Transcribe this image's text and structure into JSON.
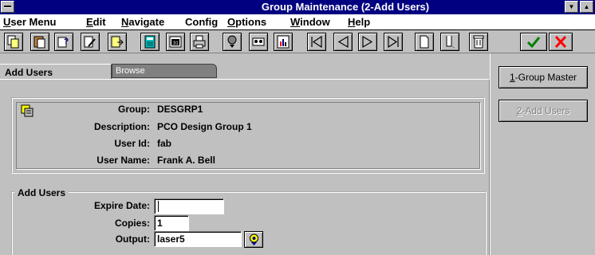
{
  "window": {
    "title": "Group Maintenance (2-Add Users)",
    "minimize_icon": "down-triangle",
    "maximize_icon": "up-triangle"
  },
  "menu": [
    {
      "label": "User Menu",
      "mnemonic": "U"
    },
    {
      "label": "Edit",
      "mnemonic": "E"
    },
    {
      "label": "Navigate",
      "mnemonic": "N"
    },
    {
      "label": "Config",
      "mnemonic": "C"
    },
    {
      "label": "Options",
      "mnemonic": "O"
    },
    {
      "label": "Window",
      "mnemonic": "W"
    },
    {
      "label": "Help",
      "mnemonic": "H"
    }
  ],
  "toolbar": [
    {
      "icon": "copy-icon"
    },
    {
      "icon": "paste-icon"
    },
    {
      "icon": "query-icon"
    },
    {
      "icon": "edit-query-icon"
    },
    {
      "icon": "transfer-icon"
    },
    {
      "icon": "calculator-icon"
    },
    {
      "icon": "calendar-icon"
    },
    {
      "icon": "print-icon"
    },
    {
      "icon": "lookup-icon"
    },
    {
      "icon": "cassette-icon"
    },
    {
      "icon": "chart-icon"
    },
    {
      "icon": "first-record-icon"
    },
    {
      "icon": "previous-record-icon"
    },
    {
      "icon": "next-record-icon"
    },
    {
      "icon": "last-record-icon"
    },
    {
      "icon": "new-record-icon"
    },
    {
      "icon": "insert-record-icon"
    },
    {
      "icon": "delete-record-icon"
    },
    {
      "icon": "accept-icon",
      "color": "#008000"
    },
    {
      "icon": "cancel-icon",
      "color": "#ff0000"
    }
  ],
  "tabs": {
    "active": "Add Users",
    "inactive": "Browse"
  },
  "group_info": {
    "group_label": "Group:",
    "group_value": "DESGRP1",
    "description_label": "Description:",
    "description_value": "PCO Design Group 1",
    "userid_label": "User Id:",
    "userid_value": "fab",
    "username_label": "User Name:",
    "username_value": "Frank A. Bell"
  },
  "add_users": {
    "legend": "Add Users",
    "expire_label": "Expire Date:",
    "expire_value": "",
    "copies_label": "Copies:",
    "copies_value": "1",
    "output_label": "Output:",
    "output_value": "laser5"
  },
  "side_buttons": [
    {
      "prefix": "1",
      "label": "-Group Master",
      "enabled": true
    },
    {
      "prefix": "2",
      "label": "-Add Users",
      "enabled": false
    }
  ]
}
